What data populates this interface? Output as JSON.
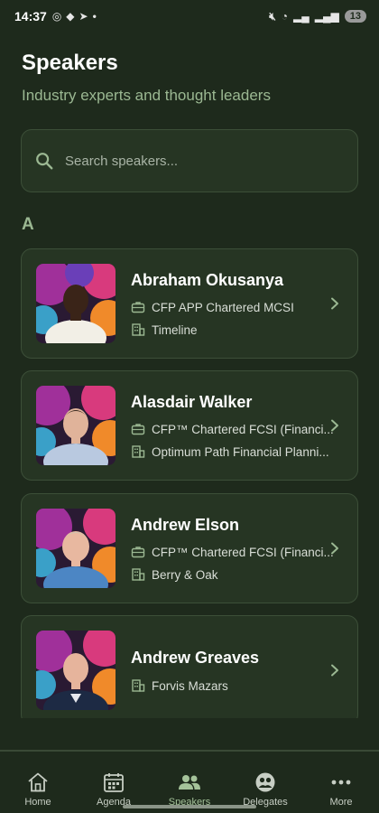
{
  "status_bar": {
    "time": "14:37",
    "left_icons": [
      "camera-icon",
      "teams-icon",
      "telegram-icon",
      "dot-icon"
    ],
    "battery": "13"
  },
  "header": {
    "title": "Speakers",
    "subtitle": "Industry experts and thought leaders"
  },
  "search": {
    "placeholder": "Search speakers..."
  },
  "section": {
    "letter": "A"
  },
  "speakers": [
    {
      "name": "Abraham Okusanya",
      "credentials": "CFP APP Chartered MCSI",
      "company": "Timeline"
    },
    {
      "name": "Alasdair Walker",
      "credentials": "CFP™ Chartered FCSI (Financi...",
      "company": "Optimum Path Financial Planni..."
    },
    {
      "name": "Andrew Elson",
      "credentials": "CFP™ Chartered FCSI (Financi...",
      "company": "Berry & Oak"
    },
    {
      "name": "Andrew Greaves",
      "company": "Forvis Mazars"
    }
  ],
  "nav": {
    "items": [
      {
        "label": "Home",
        "icon": "home-icon"
      },
      {
        "label": "Agenda",
        "icon": "calendar-icon"
      },
      {
        "label": "Speakers",
        "icon": "people-icon"
      },
      {
        "label": "Delegates",
        "icon": "delegates-icon"
      },
      {
        "label": "More",
        "icon": "more-icon"
      }
    ],
    "active": "Speakers"
  },
  "colors": {
    "background": "#1e2a1c",
    "card": "#263523",
    "accent": "#9bb892"
  }
}
